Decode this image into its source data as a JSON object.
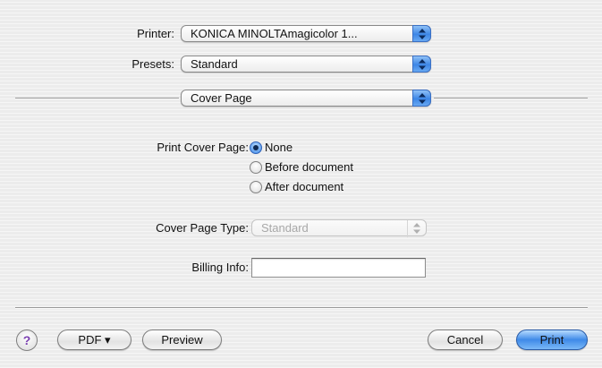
{
  "printer": {
    "label": "Printer:",
    "value": "KONICA MINOLTAmagicolor 1..."
  },
  "presets": {
    "label": "Presets:",
    "value": "Standard"
  },
  "panel_selector": {
    "value": "Cover Page"
  },
  "cover_page": {
    "label": "Print Cover Page:",
    "options": [
      "None",
      "Before document",
      "After document"
    ],
    "selected": "None"
  },
  "cover_page_type": {
    "label": "Cover Page Type:",
    "value": "Standard"
  },
  "billing_info": {
    "label": "Billing Info:",
    "value": ""
  },
  "buttons": {
    "help": "?",
    "pdf": "PDF ▾",
    "preview": "Preview",
    "cancel": "Cancel",
    "print": "Print"
  }
}
